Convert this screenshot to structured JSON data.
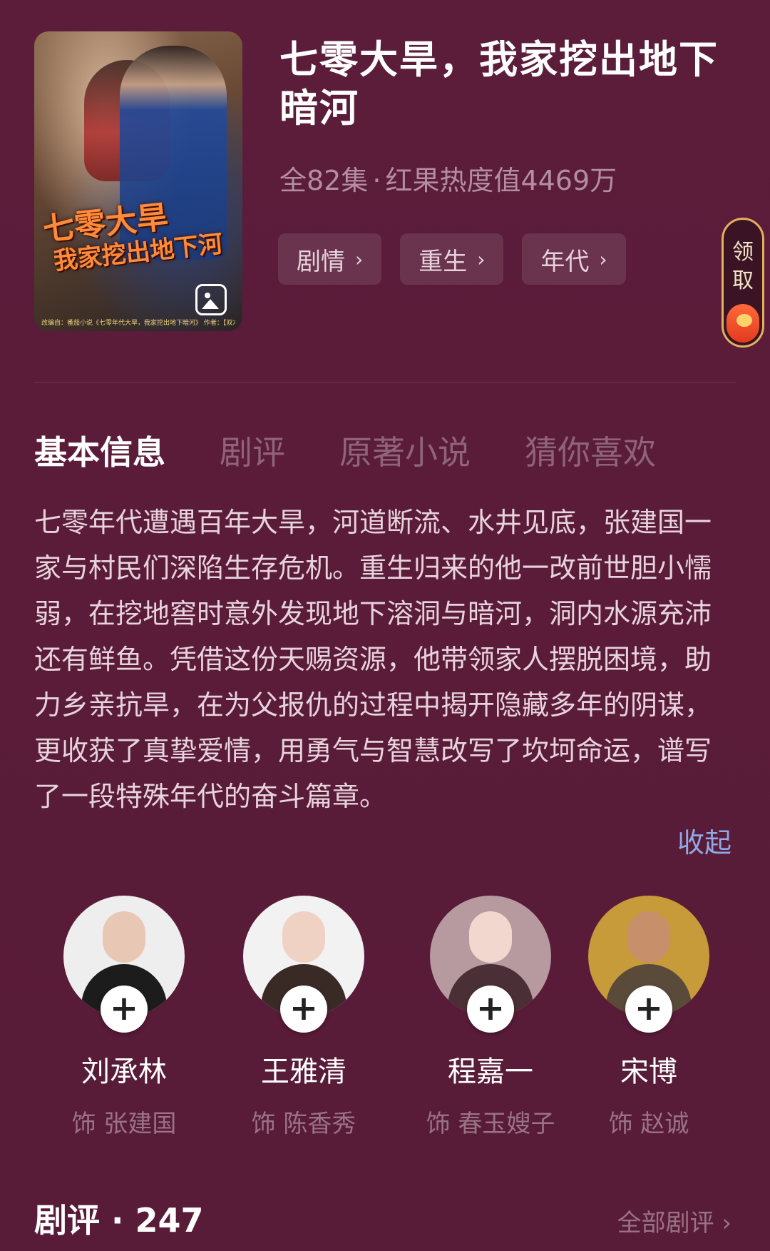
{
  "drama": {
    "title": "七零大旱，我家挖出地下暗河",
    "episodes": "全82集",
    "separator": "·",
    "heat": "红果热度值4469万",
    "cover_text_line1": "七零大旱",
    "cover_text_line2": "我家挖出地下河",
    "cover_credits": "改编自：番茄小说《七零年代大旱，我家挖出地下暗河》 作者：【双木成林】"
  },
  "tags": [
    {
      "label": "剧情",
      "icon": "chevron-right-icon"
    },
    {
      "label": "重生",
      "icon": "chevron-right-icon"
    },
    {
      "label": "年代",
      "icon": "chevron-right-icon"
    }
  ],
  "reward": {
    "label": "领取",
    "icon": "coin-purse-icon"
  },
  "tabs": [
    {
      "label": "基本信息",
      "active": true
    },
    {
      "label": "剧评",
      "active": false
    },
    {
      "label": "原著小说",
      "active": false
    },
    {
      "label": "猜你喜欢",
      "active": false
    }
  ],
  "synopsis": {
    "text": "七零年代遭遇百年大旱，河道断流、水井见底，张建国一家与村民们深陷生存危机。重生归来的他一改前世胆小懦弱，在挖地窖时意外发现地下溶洞与暗河，洞内水源充沛还有鲜鱼。凭借这份天赐资源，他带领家人摆脱困境，助力乡亲抗旱，在为父报仇的过程中揭开隐藏多年的阴谋，更收获了真挚爱情，用勇气与智慧改写了坎坷命运，谱写了一段特殊年代的奋斗篇章。",
    "collapse_label": "收起"
  },
  "cast": [
    {
      "name": "刘承林",
      "role": "饰 张建国",
      "follow_icon": "plus-icon"
    },
    {
      "name": "王雅清",
      "role": "饰 陈香秀",
      "follow_icon": "plus-icon"
    },
    {
      "name": "程嘉一",
      "role": "饰 春玉嫂子",
      "follow_icon": "plus-icon"
    },
    {
      "name": "宋博",
      "role": "饰 赵诚",
      "follow_icon": "plus-icon"
    }
  ],
  "reviews": {
    "title": "剧评 · 247",
    "all_label": "全部剧评 ›"
  },
  "colors": {
    "background": "#5a1c39",
    "tag_text": "#e6d2dc",
    "muted_text": "#9a7385",
    "link": "#8fa9e6",
    "inactive_tab": "#8f6479"
  }
}
